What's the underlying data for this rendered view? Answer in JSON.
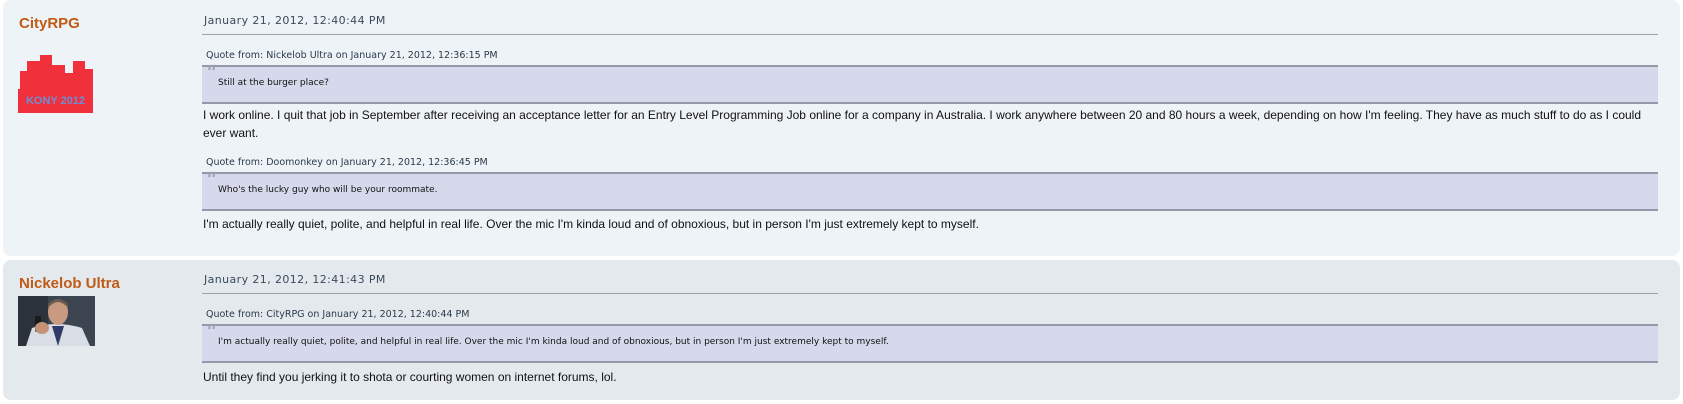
{
  "posts": [
    {
      "author": "CityRPG",
      "avatar": {
        "label": "KONY 2012",
        "color": "#f0303a",
        "label_color": "#6a8fd8"
      },
      "date": "January 21, 2012, 12:40:44 PM",
      "quote1": {
        "header": "Quote from: Nickelob Ultra on January 21, 2012, 12:36:15 PM",
        "text": "Still at the burger place?"
      },
      "reply1": "I work online. I quit that job in September after receiving an acceptance letter for an Entry Level Programming Job  online for a company in Australia. I work anywhere between 20 and 80 hours a week, depending on how I'm feeling. They have as much stuff to do as I could ever want.",
      "quote2": {
        "header": "Quote from: Doomonkey on January 21, 2012, 12:36:45 PM",
        "text": "Who's the lucky guy who will be your roommate."
      },
      "reply2": "I'm actually really quiet, polite, and helpful in real life. Over the mic I'm kinda loud and of obnoxious, but in person I'm just extremely kept to myself."
    },
    {
      "author": "Nickelob Ultra",
      "date": "January 21, 2012, 12:41:43 PM",
      "quote1": {
        "header": "Quote from: CityRPG on January 21, 2012, 12:40:44 PM",
        "text": "I'm actually really quiet, polite, and helpful in real life. Over the mic I'm kinda loud and of obnoxious, but in person I'm just extremely kept to myself."
      },
      "reply1": "Until they find you jerking it to shota or courting women on internet forums, lol."
    }
  ],
  "icons": {
    "quote_mark": "quote-icon"
  }
}
